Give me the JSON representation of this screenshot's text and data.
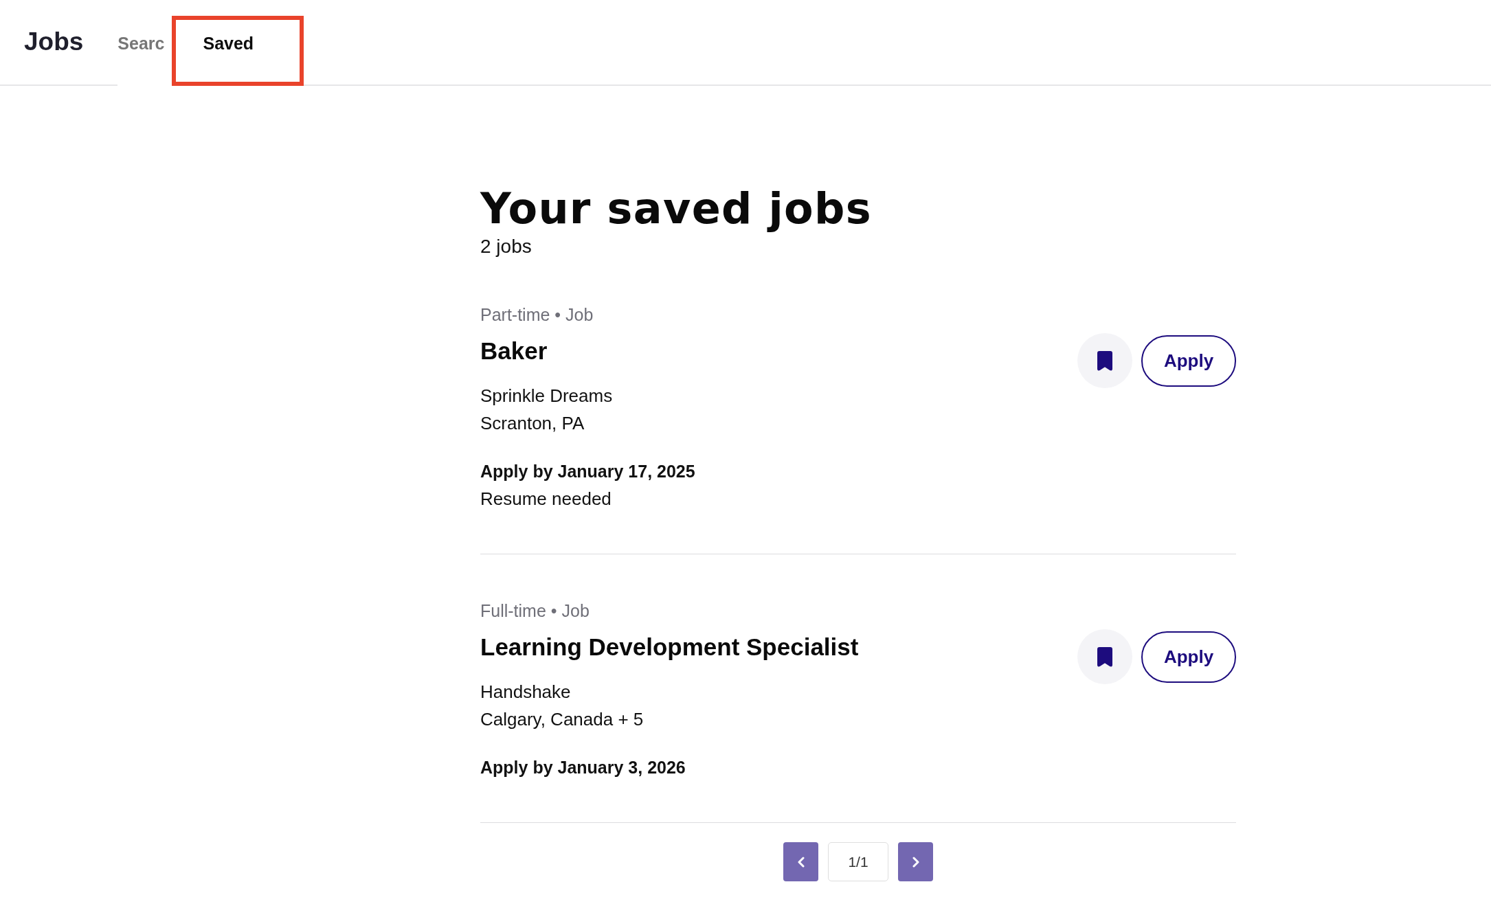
{
  "header": {
    "brand": "Jobs",
    "tabs": [
      {
        "label": "Searc",
        "selected": false,
        "focused": false
      },
      {
        "label": "Saved",
        "selected": true,
        "focused": true
      }
    ]
  },
  "page": {
    "title": "Your saved jobs",
    "count": "2 jobs"
  },
  "jobs": [
    {
      "meta": "Part-time • Job",
      "title": "Baker",
      "employer": "Sprinkle Dreams",
      "location": "Scranton, PA",
      "deadline": "Apply by January 17, 2025",
      "requirement": "Resume needed",
      "saved": true,
      "apply_label": "Apply"
    },
    {
      "meta": "Full-time • Job",
      "title": "Learning Development Specialist",
      "employer": "Handshake",
      "location": "Calgary, Canada + 5",
      "deadline": "Apply by January 3, 2026",
      "saved": true,
      "apply_label": "Apply"
    }
  ],
  "pagination": {
    "page": "1/1"
  }
}
